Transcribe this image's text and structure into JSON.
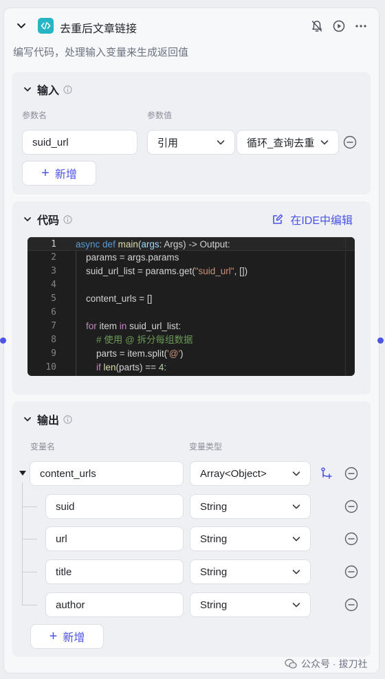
{
  "header": {
    "title": "去重后文章链接",
    "description": "编写代码，处理输入变量来生成返回值"
  },
  "input_section": {
    "title": "输入",
    "col_name": "参数名",
    "col_value": "参数值",
    "param": {
      "name": "suid_url",
      "source_type": "引用",
      "reference": "循环_查询去重"
    },
    "add_label": "新增"
  },
  "code_section": {
    "title": "代码",
    "ide_label": "在IDE中编辑",
    "line_numbers": [
      "1",
      "2",
      "3",
      "4",
      "5",
      "6",
      "7",
      "8",
      "9",
      "10"
    ]
  },
  "output_section": {
    "title": "输出",
    "col_name": "变量名",
    "col_type": "变量类型",
    "root": {
      "name": "content_urls",
      "type": "Array<Object>"
    },
    "children": [
      {
        "name": "suid",
        "type": "String"
      },
      {
        "name": "url",
        "type": "String"
      },
      {
        "name": "title",
        "type": "String"
      },
      {
        "name": "author",
        "type": "String"
      }
    ],
    "add_label": "新增"
  },
  "watermark": {
    "text": "公众号 · 拔刀社"
  },
  "colors": {
    "accent": "#4d53e8",
    "icon_bg": "#25b5c4",
    "code_bg": "#1e1e1e"
  }
}
